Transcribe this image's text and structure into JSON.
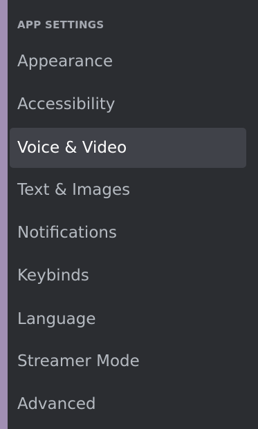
{
  "sidebar": {
    "section_header": "APP SETTINGS",
    "selected_index": 2,
    "items": [
      {
        "label": "Appearance"
      },
      {
        "label": "Accessibility"
      },
      {
        "label": "Voice & Video"
      },
      {
        "label": "Text & Images"
      },
      {
        "label": "Notifications"
      },
      {
        "label": "Keybinds"
      },
      {
        "label": "Language"
      },
      {
        "label": "Streamer Mode"
      },
      {
        "label": "Advanced"
      }
    ]
  },
  "colors": {
    "background_left_strip": "#a18fb3",
    "panel": "#2b2d31",
    "selected_item_bg": "#404249",
    "header_text": "#a5a9b1",
    "item_text": "#b5bac1",
    "selected_text": "#ffffff"
  }
}
